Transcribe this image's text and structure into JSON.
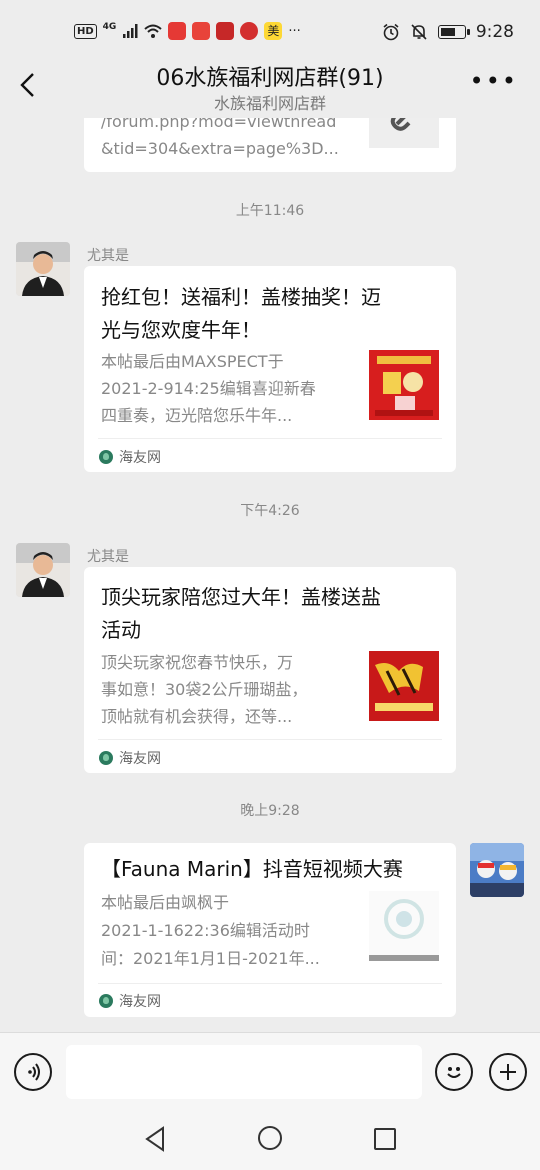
{
  "status_bar": {
    "network": "4G",
    "time": "9:28",
    "battery_level": 0.55,
    "hd_label": "HD",
    "app_icon_meituan": "美",
    "more_dots": "···",
    "app_icon_colors": [
      "#e53935",
      "#e8433a",
      "#c62828",
      "#d32f2f",
      "#fdd835"
    ]
  },
  "header": {
    "title": "06水族福利网店群(91)",
    "subtitle": "水族福利网店群"
  },
  "top_card": {
    "line1": "/forum.php?mod=viewthread",
    "line2": "&tid=304&extra=page%3D..."
  },
  "messages": [
    {
      "time": "上午11:46",
      "sender": "尤其是",
      "title_line1": "抢红包！送福利！盖楼抽奖！迈",
      "title_line2": "光与您欢度牛年！",
      "desc_line1": "本帖最后由MAXSPECT于",
      "desc_line2": "2021-2-914:25编辑喜迎新春",
      "desc_line3": "四重奏，迈光陪您乐牛年...",
      "source": "海友网"
    },
    {
      "time": "下午4:26",
      "sender": "尤其是",
      "title_line1": "顶尖玩家陪您过大年！盖楼送盐",
      "title_line2": "活动",
      "desc_line1": "顶尖玩家祝您春节快乐，万",
      "desc_line2": "事如意！30袋2公斤珊瑚盐，",
      "desc_line3": "顶帖就有机会获得，还等...",
      "source": "海友网"
    },
    {
      "time": "晚上9:28",
      "title_line1": "【Fauna Marin】抖音短视频大赛",
      "desc_line1": "本帖最后由飒枫于",
      "desc_line2": "2021-1-1622:36编辑活动时",
      "desc_line3": "间：2021年1月1日-2021年...",
      "source": "海友网"
    }
  ]
}
